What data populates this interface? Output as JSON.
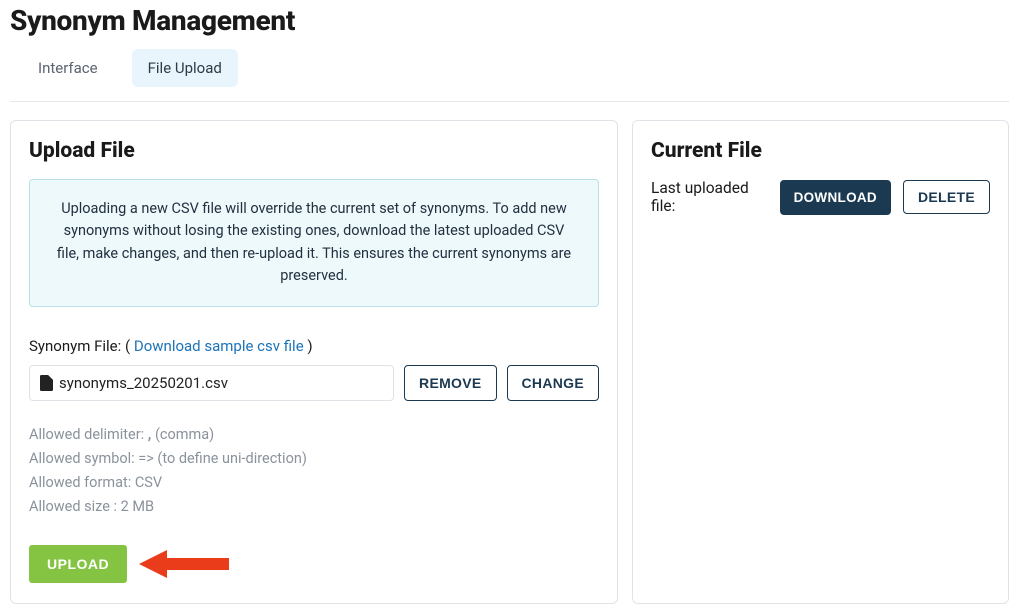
{
  "page_title": "Synonym Management",
  "tabs": {
    "interface": "Interface",
    "file_upload": "File Upload"
  },
  "upload": {
    "title": "Upload File",
    "info": "Uploading a new CSV file will override the current set of synonyms. To add new synonyms without losing the existing ones, download the latest uploaded CSV file, make changes, and then re-upload it. This ensures the current synonyms are preserved.",
    "file_label_prefix": "Synonym File: ( ",
    "sample_link": "Download sample csv file",
    "file_label_suffix": " )",
    "selected_file": "synonyms_20250201.csv",
    "remove_label": "REMOVE",
    "change_label": "CHANGE",
    "hints": {
      "delimiter_label": "Allowed delimiter: ",
      "delimiter_value": ",",
      "delimiter_note": " (comma)",
      "symbol": "Allowed symbol: => (to define uni-direction)",
      "format": "Allowed format: CSV",
      "size": "Allowed size : 2 MB"
    },
    "upload_label": "UPLOAD"
  },
  "current": {
    "title": "Current File",
    "last_label": "Last uploaded file:",
    "download_label": "DOWNLOAD",
    "delete_label": "DELETE"
  },
  "colors": {
    "accent_green": "#85c442",
    "accent_dark": "#1b3a52",
    "info_bg": "#eef9fb",
    "arrow": "#ea3b1a"
  }
}
